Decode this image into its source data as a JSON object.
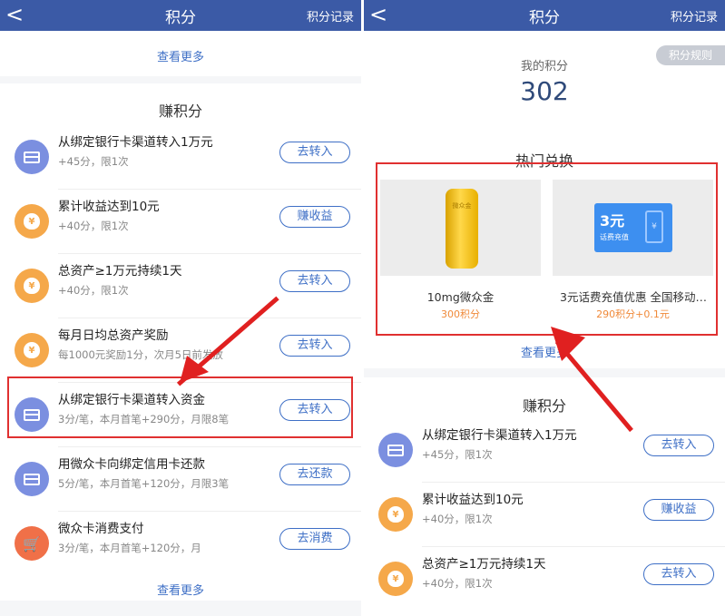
{
  "left": {
    "nav": {
      "back": "<",
      "title": "积分",
      "right": "积分记录"
    },
    "more_top": "查看更多",
    "section_title": "赚积分",
    "rows": [
      {
        "title": "从绑定银行卡渠道转入1万元",
        "sub": "+45分，限1次",
        "btn": "去转入",
        "icon": "card-icon",
        "color": "blue"
      },
      {
        "title": "累计收益达到10元",
        "sub": "+40分，限1次",
        "btn": "赚收益",
        "icon": "money-bag-icon",
        "color": "orange"
      },
      {
        "title": "总资产≥1万元持续1天",
        "sub": "+40分，限1次",
        "btn": "去转入",
        "icon": "money-bag-icon",
        "color": "orange"
      },
      {
        "title": "每月日均总资产奖励",
        "sub": "每1000元奖励1分，次月5日前发放",
        "btn": "去转入",
        "icon": "money-bag-icon",
        "color": "orange"
      },
      {
        "title": "从绑定银行卡渠道转入资金",
        "sub": "3分/笔，本月首笔+290分，月限8笔",
        "btn": "去转入",
        "icon": "card-icon",
        "color": "blue"
      },
      {
        "title": "用微众卡向绑定信用卡还款",
        "sub": "5分/笔，本月首笔+120分，月限3笔",
        "btn": "去还款",
        "icon": "card-icon",
        "color": "blue"
      },
      {
        "title": "微众卡消费支付",
        "sub": "3分/笔，本月首笔+120分，月",
        "btn": "去消费",
        "icon": "cart-icon",
        "color": "red"
      }
    ],
    "more_bottom": "查看更多"
  },
  "right": {
    "nav": {
      "back": "<",
      "title": "积分",
      "right": "积分记录"
    },
    "my_score_label": "我的积分",
    "my_score": "302",
    "rules": "积分规则",
    "hot_title": "热门兑换",
    "products": [
      {
        "name": "10mg微众金",
        "price": "300积分",
        "image_text": "微众金"
      },
      {
        "name": "3元话费充值优惠 全国移动…",
        "price": "290积分+0.1元",
        "image_amount": "3元",
        "image_sub": "话费充值",
        "image_phone": "¥"
      }
    ],
    "more": "查看更多",
    "section_title": "赚积分",
    "rows": [
      {
        "title": "从绑定银行卡渠道转入1万元",
        "sub": "+45分，限1次",
        "btn": "去转入",
        "icon": "card-icon",
        "color": "blue"
      },
      {
        "title": "累计收益达到10元",
        "sub": "+40分，限1次",
        "btn": "赚收益",
        "icon": "money-bag-icon",
        "color": "orange"
      },
      {
        "title": "总资产≥1万元持续1天",
        "sub": "+40分，限1次",
        "btn": "去转入",
        "icon": "money-bag-icon",
        "color": "orange"
      }
    ]
  },
  "colors": {
    "nav": "#3b5aa6",
    "accent": "#3e6fc6",
    "highlight": "#e03030",
    "points": "#f08a3a"
  }
}
